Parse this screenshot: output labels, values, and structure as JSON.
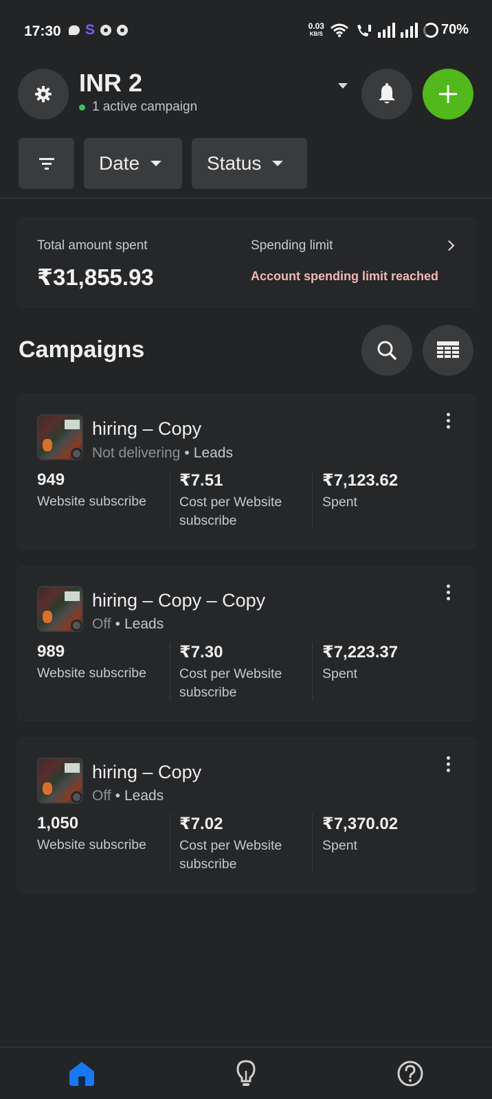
{
  "status_bar": {
    "time": "17:30",
    "speed_value": "0.03",
    "speed_unit": "KB/S",
    "battery": "70%",
    "app_icon_letter": "S"
  },
  "header": {
    "account_name": "INR 2",
    "active_campaigns": "1 active campaign",
    "accent_green": "#52b81c",
    "icons": [
      "gear-icon",
      "bell-icon",
      "plus-icon",
      "chevron-down-icon"
    ]
  },
  "filters": {
    "date_label": "Date",
    "status_label": "Status"
  },
  "summary": {
    "total_label": "Total amount spent",
    "total_value": "₹31,855.93",
    "limit_label": "Spending limit",
    "limit_status": "Account spending limit reached"
  },
  "campaigns_section": {
    "title": "Campaigns"
  },
  "campaigns": [
    {
      "name": "hiring – Copy",
      "status": "Not delivering",
      "objective": "Leads",
      "results": "949",
      "results_label": "Website subscribe",
      "cost": "₹7.51",
      "cost_label": "Cost per Website subscribe",
      "spent": "₹7,123.62",
      "spent_label": "Spent"
    },
    {
      "name": "hiring – Copy – Copy",
      "status": "Off",
      "objective": "Leads",
      "results": "989",
      "results_label": "Website subscribe",
      "cost": "₹7.30",
      "cost_label": "Cost per Website subscribe",
      "spent": "₹7,223.37",
      "spent_label": "Spent"
    },
    {
      "name": "hiring – Copy",
      "status": "Off",
      "objective": "Leads",
      "results": "1,050",
      "results_label": "Website subscribe",
      "cost": "₹7.02",
      "cost_label": "Cost per Website subscribe",
      "spent": "₹7,370.02",
      "spent_label": "Spent"
    }
  ],
  "bottom_nav": {
    "items": [
      "home-icon",
      "lightbulb-icon",
      "help-icon"
    ],
    "active_color": "#1877f2"
  }
}
